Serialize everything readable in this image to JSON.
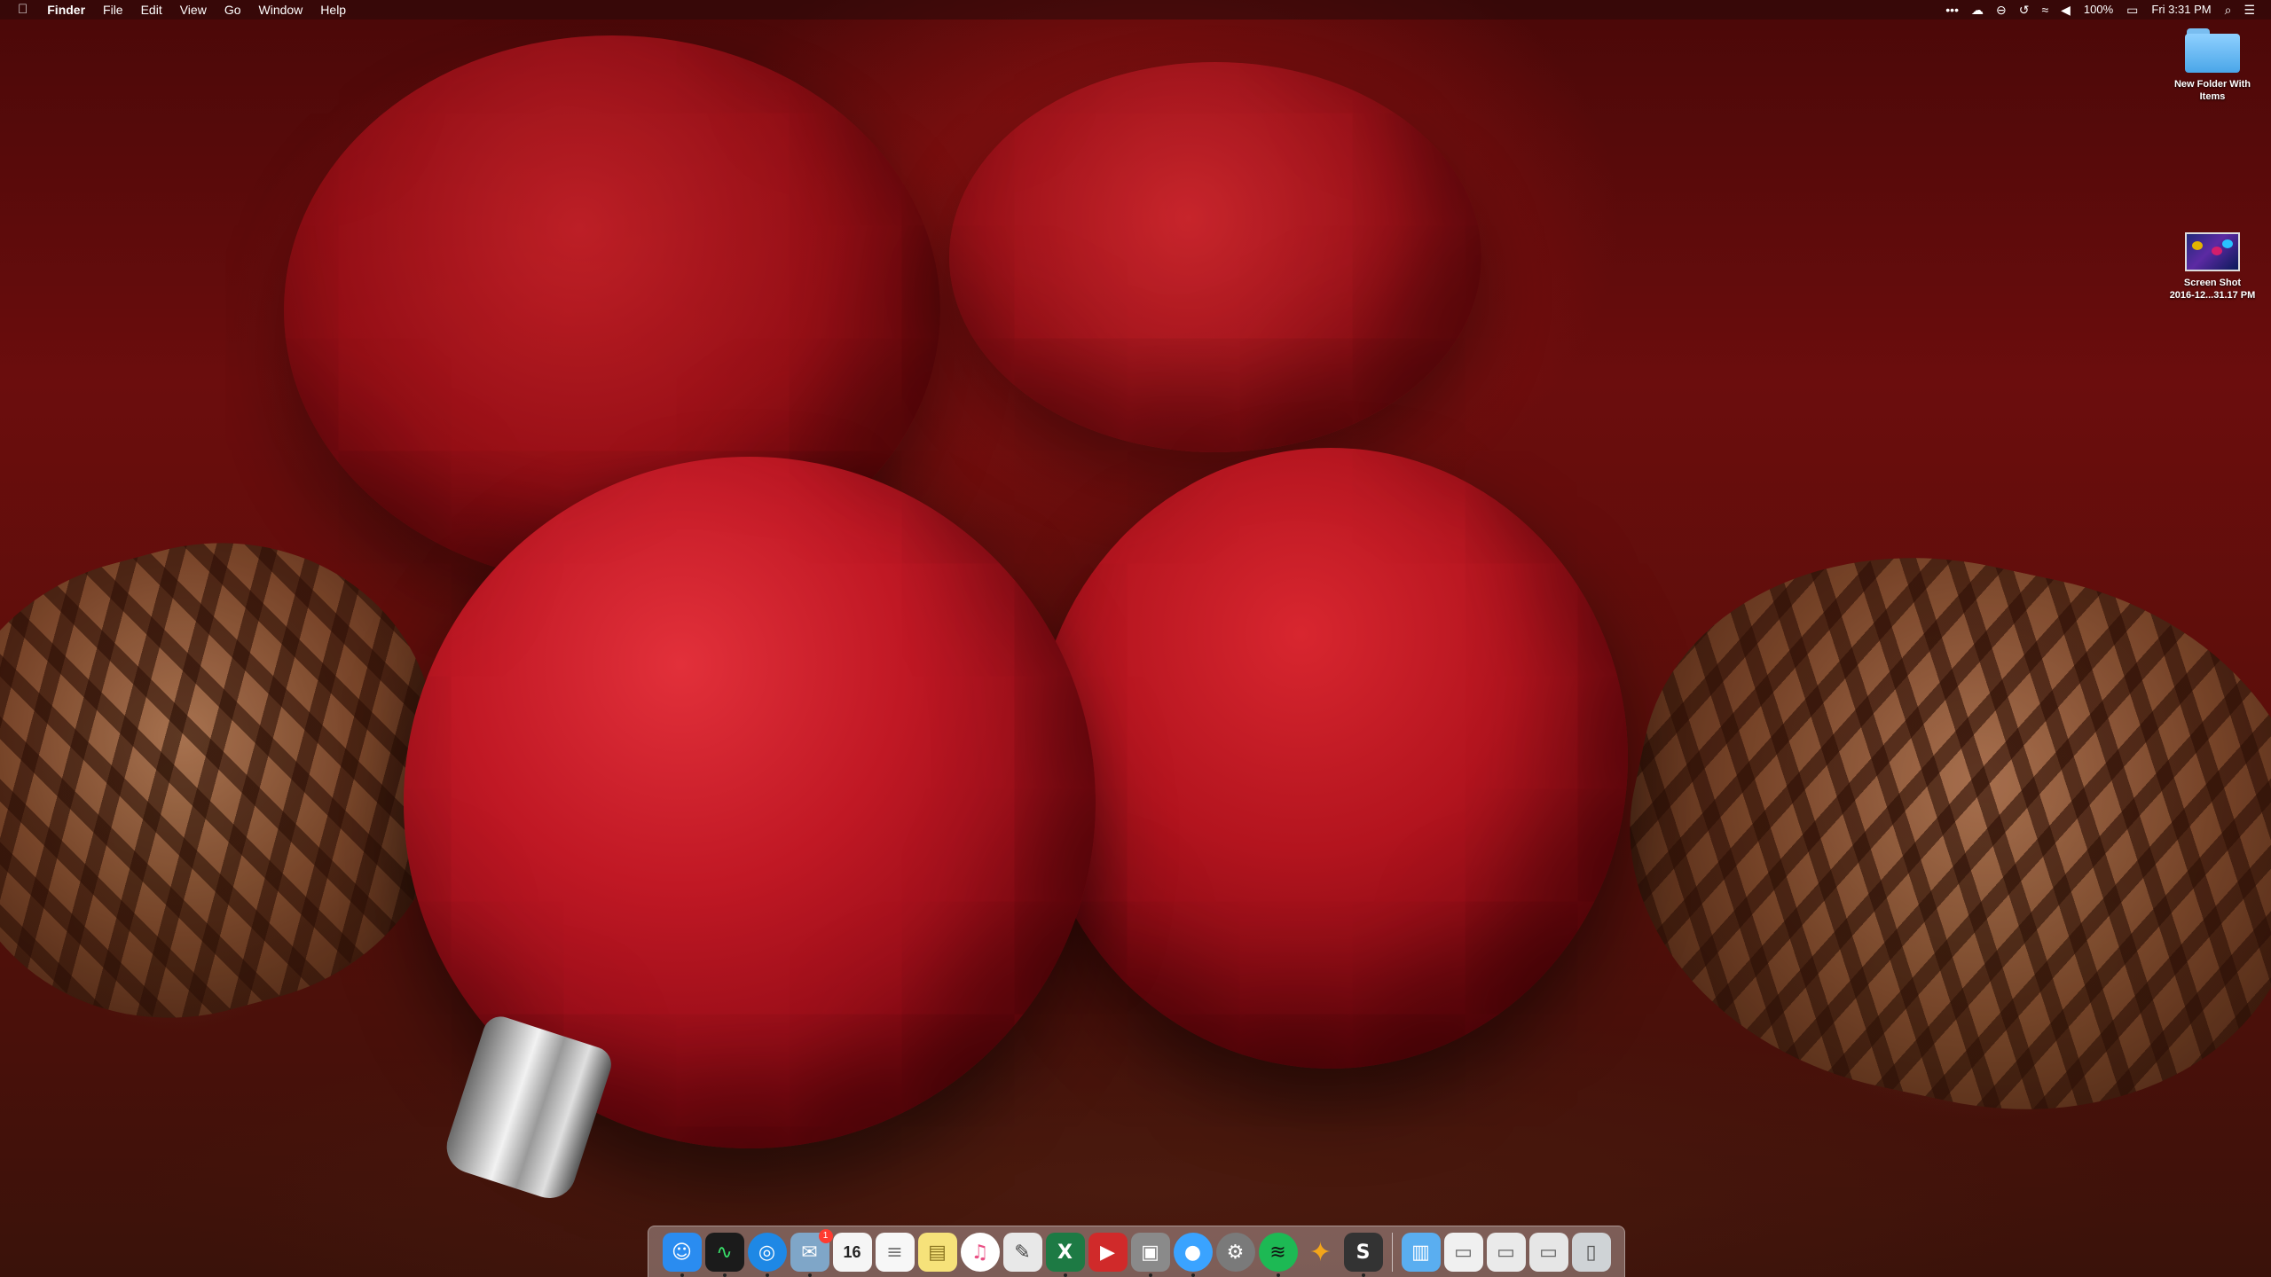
{
  "menubar": {
    "apple_icon": "",
    "app_name": "Finder",
    "menus": [
      "File",
      "Edit",
      "View",
      "Go",
      "Window",
      "Help"
    ],
    "status": {
      "more_icon": "•••",
      "battery_percent": "100%",
      "clock": "Fri 3:31 PM"
    }
  },
  "desktop": {
    "icons": [
      {
        "label_line1": "New Folder With",
        "label_line2": "Items",
        "icon": "folder-icon"
      },
      {
        "label_line1": "Screen Shot",
        "label_line2": "2016-12...31.17 PM",
        "icon": "screenshot-thumbnail"
      }
    ]
  },
  "dock": {
    "items": [
      {
        "name": "finder",
        "glyph": "☺",
        "color": "#2a8cf0"
      },
      {
        "name": "activity-monitor",
        "glyph": "∿",
        "color": "#1b1b1b"
      },
      {
        "name": "safari",
        "glyph": "◎",
        "color": "#1e88e5"
      },
      {
        "name": "mail",
        "glyph": "✉",
        "color": "#7fa6c8",
        "badge": "1"
      },
      {
        "name": "calendar",
        "glyph": "16",
        "color": "#f5f5f5"
      },
      {
        "name": "reminders",
        "glyph": "≡",
        "color": "#f7f7f7"
      },
      {
        "name": "notes",
        "glyph": "▤",
        "color": "#f6e27a"
      },
      {
        "name": "itunes",
        "glyph": "♫",
        "color": "#e94f84"
      },
      {
        "name": "textedit",
        "glyph": "✎",
        "color": "#e8e8e8"
      },
      {
        "name": "excel",
        "glyph": "X",
        "color": "#1d7a44"
      },
      {
        "name": "pdf-reader",
        "glyph": "▶",
        "color": "#d02a2a"
      },
      {
        "name": "archive-utility",
        "glyph": "▣",
        "color": "#8a8a8a"
      },
      {
        "name": "messages",
        "glyph": "●",
        "color": "#3aa3ff"
      },
      {
        "name": "system-preferences",
        "glyph": "⚙",
        "color": "#7a7a7a"
      },
      {
        "name": "spotify",
        "glyph": "≋",
        "color": "#1db954"
      },
      {
        "name": "tes",
        "glyph": "✦",
        "color": "#f3a51a"
      },
      {
        "name": "scrivener",
        "glyph": "S",
        "color": "#333333"
      }
    ],
    "stack_items": [
      {
        "name": "applications-folder",
        "glyph": "▥",
        "color": "#5aaef0"
      },
      {
        "name": "downloads-stack",
        "glyph": "▭",
        "color": "#f0f0f0"
      },
      {
        "name": "documents-stack",
        "glyph": "▭",
        "color": "#eaeaea"
      },
      {
        "name": "desktop-stack",
        "glyph": "▭",
        "color": "#e6e6e6"
      },
      {
        "name": "trash",
        "glyph": "▯",
        "color": "#cfd3d6"
      }
    ]
  }
}
